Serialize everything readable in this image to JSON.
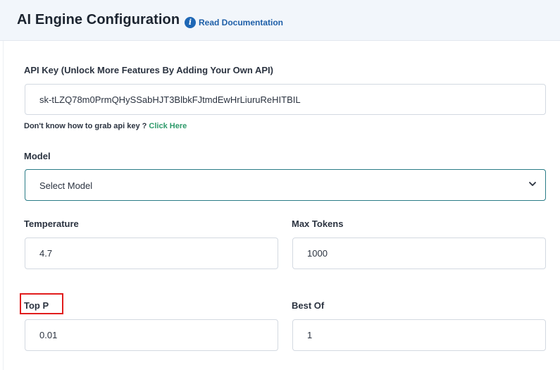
{
  "header": {
    "title": "AI Engine Configuration",
    "doc_link": "Read Documentation",
    "doc_icon": "info-icon"
  },
  "form": {
    "api_key": {
      "label": "API Key (Unlock More Features By Adding Your Own API)",
      "value": "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"
    },
    "hint": {
      "text": "Don't know how to grab api key ?",
      "link": "Click Here"
    },
    "model": {
      "label": "Model",
      "selected": "Select Model",
      "icon": "chevron-down-icon"
    },
    "temperature": {
      "label": "Temperature",
      "value": "4.7"
    },
    "max_tokens": {
      "label": "Max Tokens",
      "value": "1000"
    },
    "top_p": {
      "label": "Top P",
      "value": "0.01"
    },
    "best_of": {
      "label": "Best Of",
      "value": "1"
    }
  },
  "colors": {
    "header_bg": "#f2f6fb",
    "link_blue": "#1e5fa8",
    "link_green": "#2e9a6a",
    "select_border": "#2a7c87",
    "highlight": "#e11d1d"
  }
}
